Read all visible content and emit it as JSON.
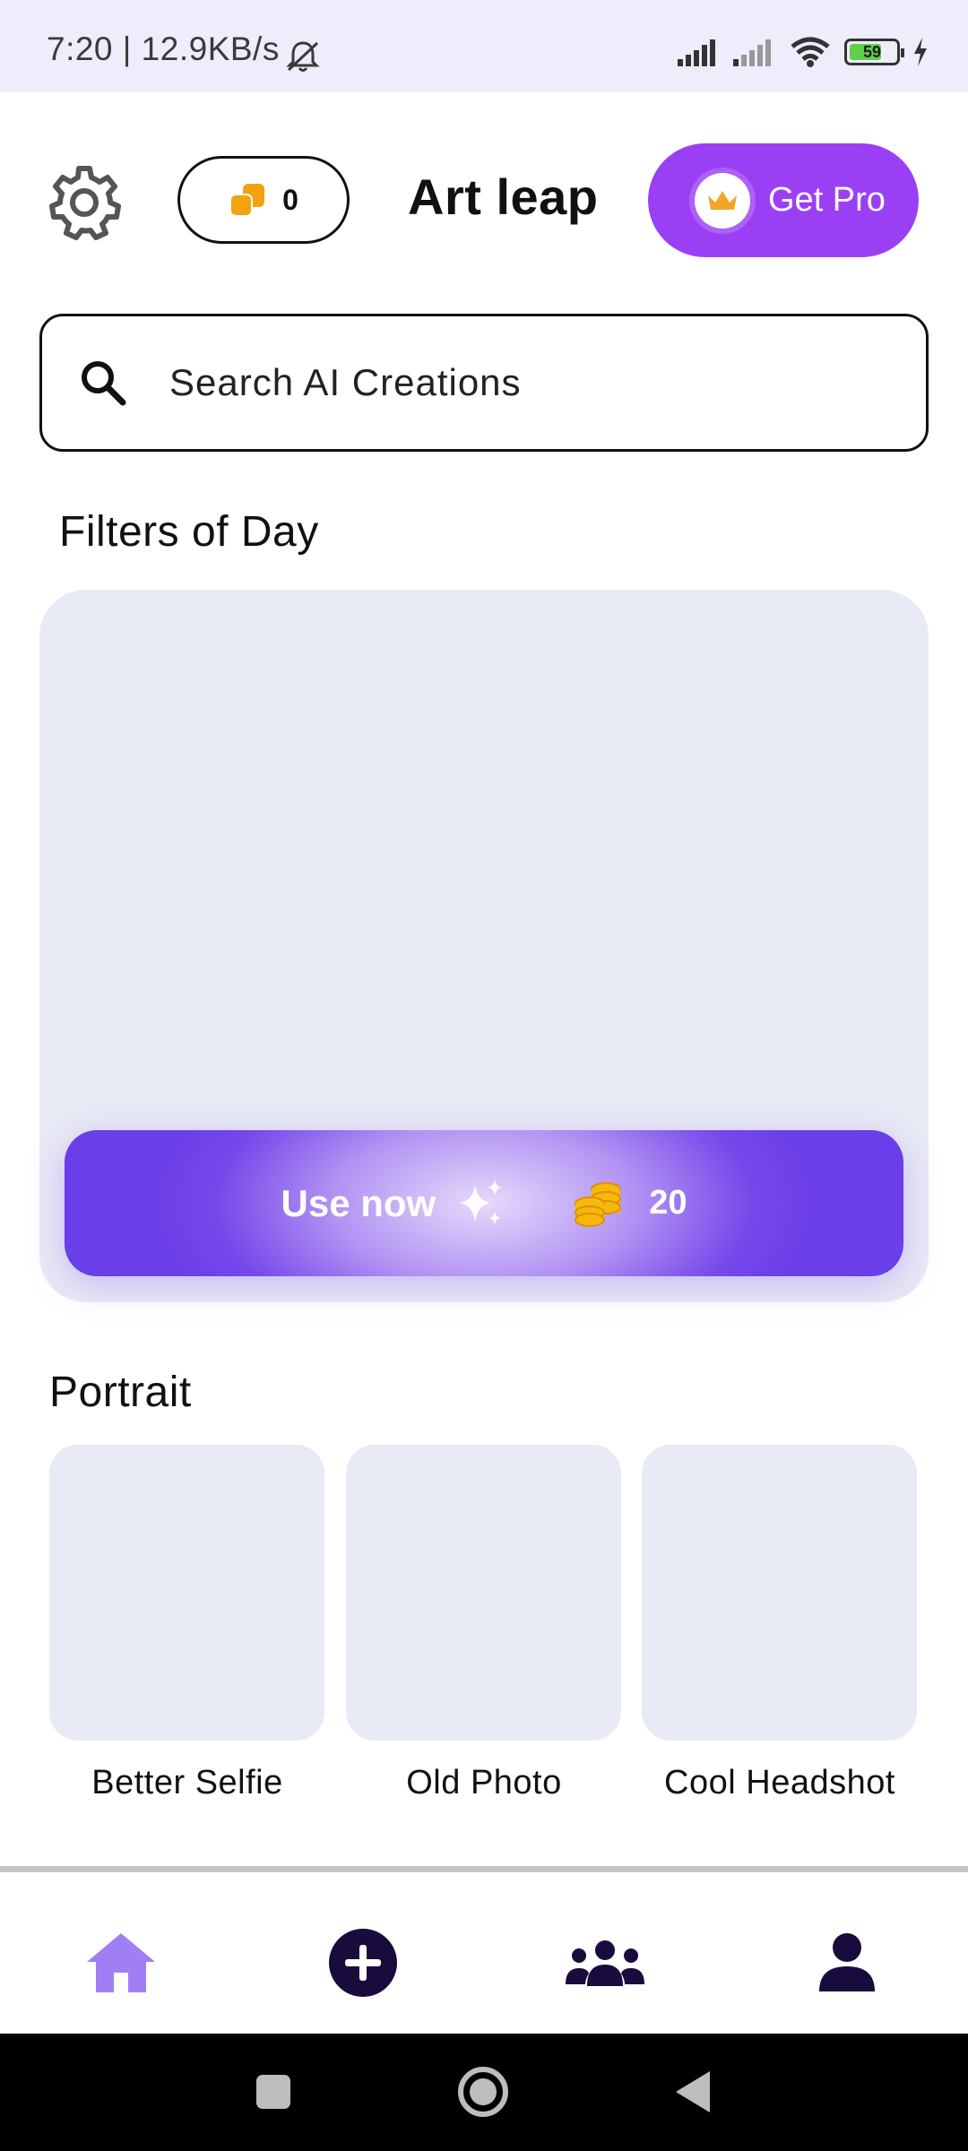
{
  "status_bar": {
    "time": "7:20 | 12.9KB/s",
    "battery": "59"
  },
  "header": {
    "coin_count": "0",
    "app_title": "Art leap",
    "pro_button_label": "Get Pro"
  },
  "search": {
    "placeholder": "Search AI Creations"
  },
  "filters_of_day": {
    "section_title": "Filters of Day",
    "cta_label": "Use now",
    "cta_cost": "20"
  },
  "portrait": {
    "section_title": "Portrait",
    "items": [
      {
        "label": "Better Selfie"
      },
      {
        "label": "Old Photo"
      },
      {
        "label": "Cool Headshot"
      }
    ]
  },
  "bottom_nav": {
    "items": [
      {
        "icon": "home-icon",
        "active": true
      },
      {
        "icon": "add-circle-icon",
        "active": false
      },
      {
        "icon": "community-icon",
        "active": false
      },
      {
        "icon": "profile-icon",
        "active": false
      }
    ]
  },
  "colors": {
    "accent": "#9b3ff5",
    "cta": "#6a3ee8",
    "nav_active": "#a07ff5",
    "nav_inactive": "#1a0b3d",
    "placeholder_bg": "#e8eaf5"
  }
}
